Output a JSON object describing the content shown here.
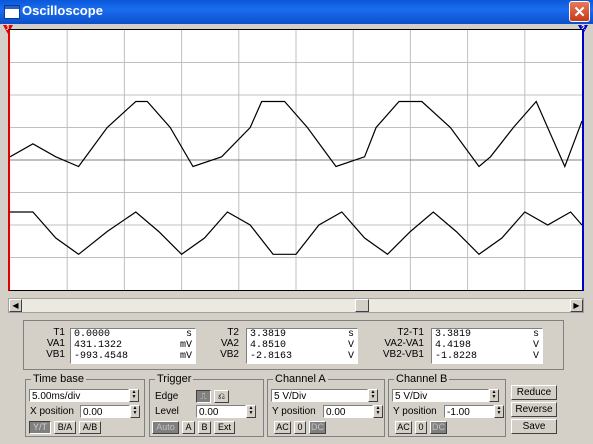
{
  "window": {
    "title": "Oscilloscope",
    "close_glyph": "✕"
  },
  "markers": {
    "cursor_1": "1",
    "cursor_2": "2"
  },
  "readouts": {
    "t1": {
      "labels": [
        "T1",
        "VA1",
        "VB1"
      ],
      "rows": [
        [
          "0.0000",
          "s"
        ],
        [
          "431.1322",
          "mV"
        ],
        [
          "-993.4548",
          "mV"
        ]
      ]
    },
    "t2": {
      "labels": [
        "T2",
        "VA2",
        "VB2"
      ],
      "rows": [
        [
          "3.3819",
          "s"
        ],
        [
          "4.8510",
          "V"
        ],
        [
          "-2.8163",
          "V"
        ]
      ]
    },
    "diff": {
      "labels": [
        "T2-T1",
        "VA2-VA1",
        "VB2-VB1"
      ],
      "rows": [
        [
          "3.3819",
          "s"
        ],
        [
          "4.4198",
          "V"
        ],
        [
          "-1.8228",
          "V"
        ]
      ]
    }
  },
  "timebase": {
    "title": "Time base",
    "scale": "5.00ms/div",
    "xpos_label": "X position",
    "xpos": "0.00",
    "modes": [
      "Y/T",
      "B/A",
      "A/B"
    ]
  },
  "trigger": {
    "title": "Trigger",
    "edge_label": "Edge",
    "level_label": "Level",
    "level": "0.00",
    "sources": [
      "Auto",
      "A",
      "B",
      "Ext"
    ]
  },
  "channel_a": {
    "title": "Channel A",
    "scale": "5 V/Div",
    "ypos_label": "Y position",
    "ypos": "0.00",
    "coupling": [
      "AC",
      "0",
      "DC"
    ]
  },
  "channel_b": {
    "title": "Channel B",
    "scale": "5 V/Div",
    "ypos_label": "Y position",
    "ypos": "-1.00",
    "coupling": [
      "AC",
      "0",
      "DC"
    ]
  },
  "actions": {
    "reduce": "Reduce",
    "reverse": "Reverse",
    "save": "Save"
  },
  "display": {
    "grid_color": "#c0c0c0",
    "trace_color": "#000000",
    "background": "#ffffff"
  },
  "chart_data": {
    "type": "line",
    "title": "",
    "xlabel": "",
    "ylabel": "",
    "grid": true,
    "divisions_x": 10,
    "divisions_y": 8,
    "series": [
      {
        "x": [
          0.0,
          0.4,
          0.8,
          1.2,
          1.7,
          2.2,
          2.4,
          2.8,
          3.2,
          3.7,
          4.2,
          4.4,
          4.8,
          5.2,
          5.7,
          6.2,
          6.4,
          6.8,
          7.2,
          7.7,
          8.2,
          8.4,
          8.8,
          9.2,
          9.7,
          10.0
        ],
        "y": [
          0.1,
          0.5,
          0.1,
          -0.2,
          1.0,
          1.8,
          1.8,
          1.0,
          -0.2,
          0.1,
          1.0,
          1.8,
          1.8,
          1.0,
          -0.2,
          0.1,
          1.0,
          1.8,
          1.8,
          1.0,
          -0.2,
          0.1,
          1.0,
          1.8,
          -0.2,
          1.2
        ]
      },
      {
        "x": [
          0.0,
          0.4,
          0.8,
          1.2,
          1.7,
          2.2,
          2.6,
          3.0,
          3.4,
          3.8,
          4.2,
          4.6,
          5.0,
          5.4,
          5.8,
          6.2,
          6.6,
          7.0,
          7.4,
          7.8,
          8.2,
          8.6,
          9.0,
          9.4,
          9.8,
          10.0
        ],
        "y": [
          -1.6,
          -1.6,
          -2.4,
          -2.9,
          -2.2,
          -1.6,
          -2.2,
          -2.9,
          -2.4,
          -1.6,
          -2.0,
          -2.9,
          -2.9,
          -2.0,
          -1.6,
          -2.4,
          -2.9,
          -2.2,
          -1.6,
          -2.2,
          -2.9,
          -2.4,
          -1.6,
          -2.0,
          -1.6,
          -2.0
        ]
      }
    ],
    "xlim": [
      0,
      10
    ],
    "ylim": [
      -4,
      4
    ]
  }
}
